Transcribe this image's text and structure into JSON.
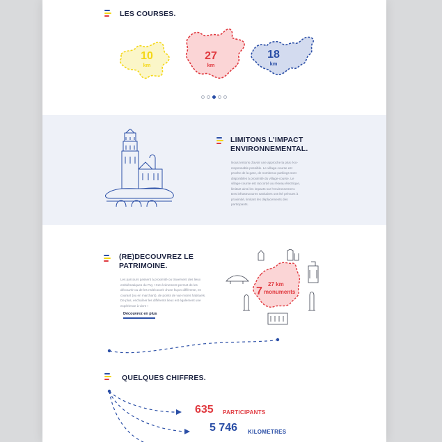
{
  "courses": {
    "title": "LES COURSES.",
    "items": [
      {
        "value": "10",
        "unit": "km",
        "color": "#f4d716",
        "fill": "#fbf6c8"
      },
      {
        "value": "27",
        "unit": "km",
        "color": "#e0393f",
        "fill": "#fbd5d6"
      },
      {
        "value": "18",
        "unit": "km",
        "color": "#2a4ea6",
        "fill": "#d3dbef"
      }
    ],
    "pagination": {
      "count": 5,
      "active": 3
    }
  },
  "impact": {
    "title_line1": "LIMITONS L’IMPACT",
    "title_line2": "ENVIRONNEMENTAL.",
    "body": "Nous tentons d’avoir une approche la plus éco-responsable possible. Le village-course est proche de la gare, de nombreux parkings sont disponibles à proximité du village-course. Le village-course est raccordé au réseau électrique, limitant ainsi les impacts sur l’environnement. Des infrastructures sanitaires ont été prévues à proximité, limitant les déplacements des participants."
  },
  "patrimoine": {
    "title_line1": "(RE)DECOUVREZ LE",
    "title_line2": "PATRIMOINE.",
    "body": "Les parcours passent à proximité ou traversent des lieux emblématiques du Puy ! Cet évènement permet de les découvrir ou de les redécouvrir d’une façon différente, en courant (ou en marchant), de points de vue moins habituels. De plus, enchaîner les différents lieux est également une expérience à vivre !",
    "link": "Découvrez en plus",
    "map_distance": "27 km",
    "map_count": "7",
    "map_label": "monuments"
  },
  "chiffres": {
    "title": "QUELQUES CHIFFRES.",
    "stats": [
      {
        "value": "635",
        "label": "PARTICIPANTS",
        "color": "#e0393f"
      },
      {
        "value": "5 746",
        "label": "KILOMETRES",
        "color": "#2a4ea6"
      }
    ]
  },
  "colors": {
    "blue": "#2a4ea6",
    "yellow": "#f4d716",
    "red": "#e0393f",
    "navy": "#1c2340"
  }
}
